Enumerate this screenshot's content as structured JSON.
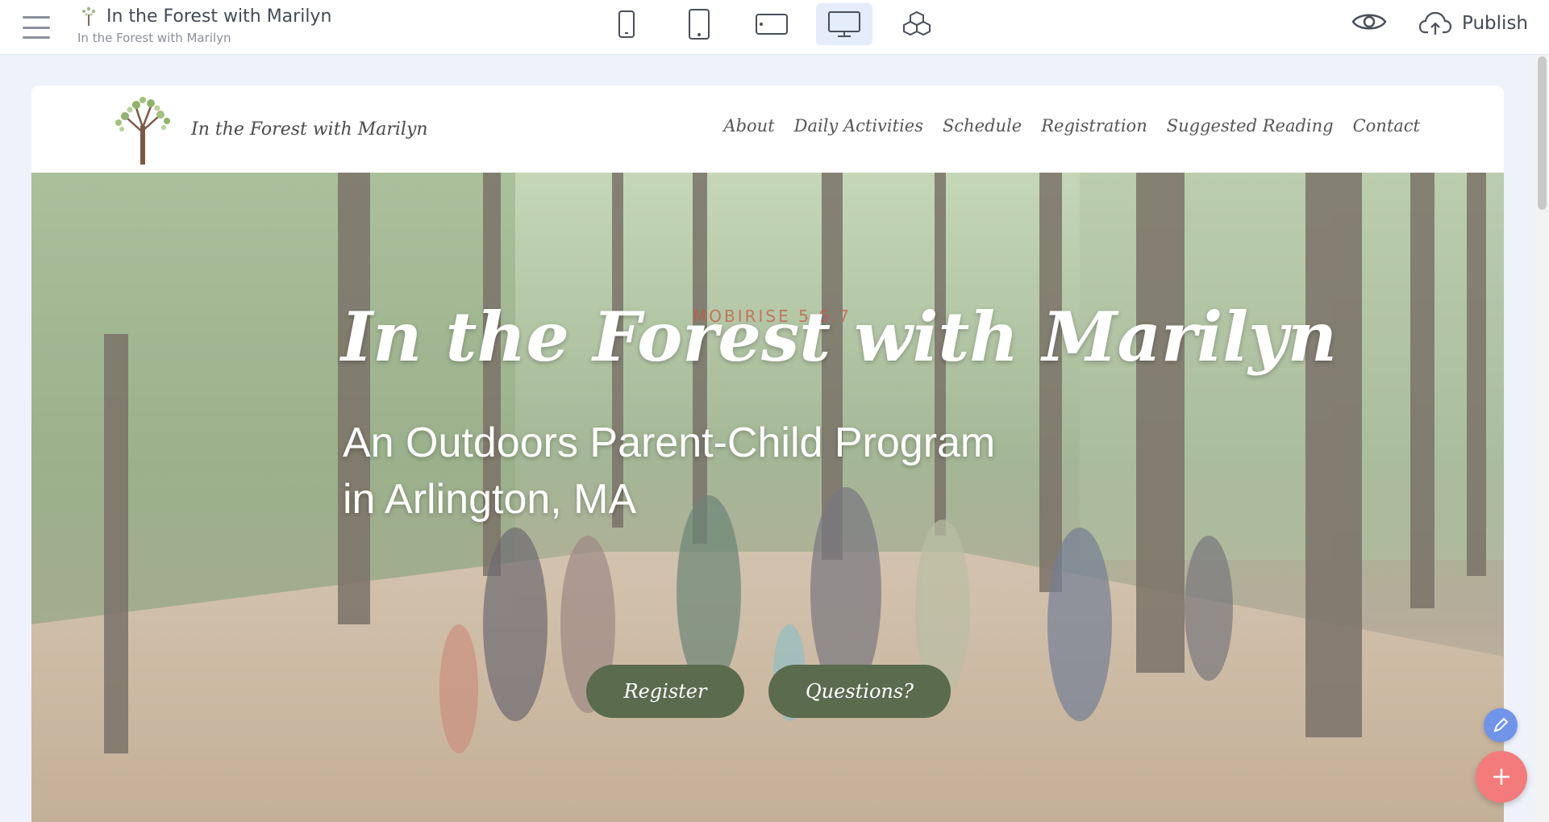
{
  "editor": {
    "project_title": "In the Forest with Marilyn",
    "project_subtitle": "In the Forest with Marilyn",
    "devices": [
      "mobile",
      "tablet-portrait",
      "tablet-landscape",
      "desktop",
      "blocks"
    ],
    "active_device": "desktop",
    "publish_label": "Publish"
  },
  "site": {
    "brand_name": "In the Forest with Marilyn",
    "menu": [
      "About",
      "Daily Activities",
      "Schedule",
      "Registration",
      "Suggested Reading",
      "Contact"
    ],
    "hero": {
      "watermark": "MOBIRISE 5.6.7",
      "title": "In the Forest with Marilyn",
      "subtitle_line1": "An Outdoors Parent-Child Program",
      "subtitle_line2": "in Arlington, MA",
      "register_button": "Register",
      "questions_button": "Questions?"
    },
    "colors": {
      "button_green": "#5a6b4e",
      "add_fab": "#f47b7b",
      "edit_fab": "#6f94e8"
    }
  }
}
